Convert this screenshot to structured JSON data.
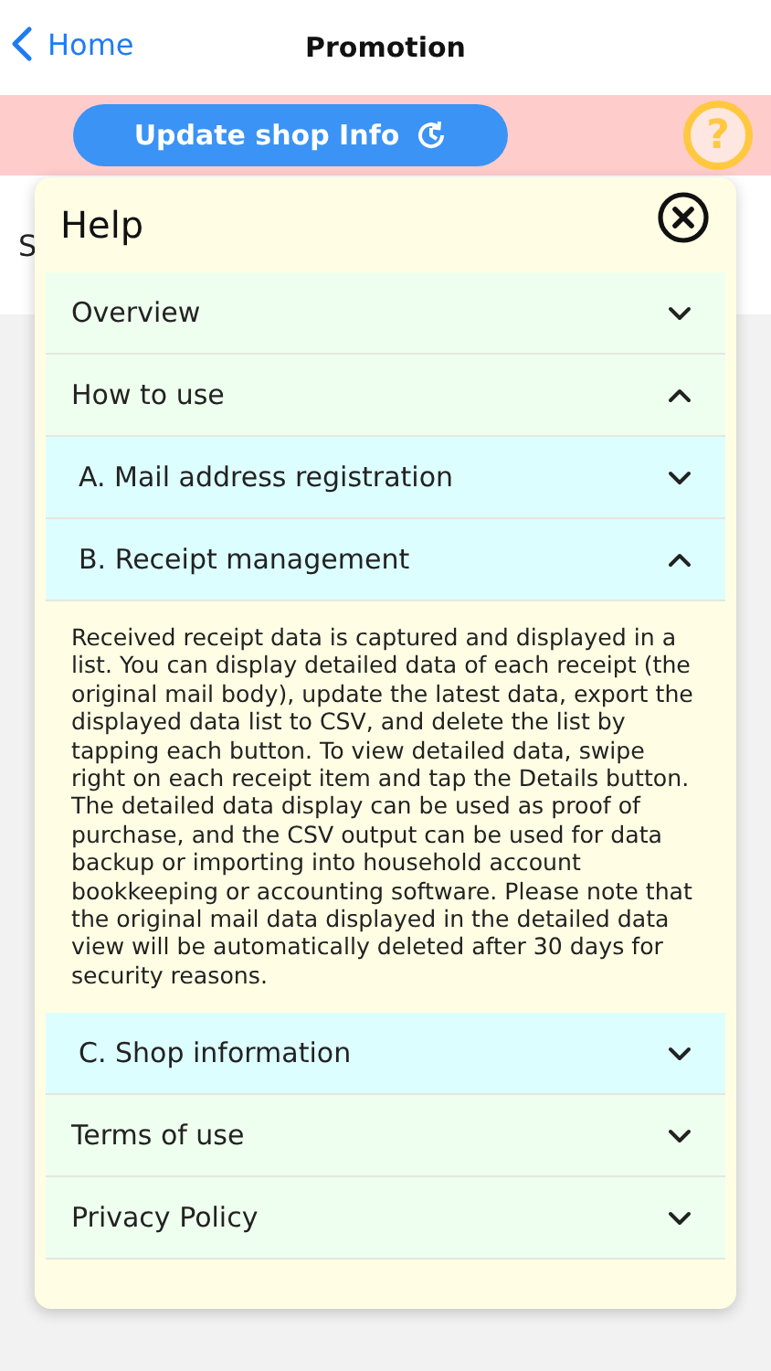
{
  "nav": {
    "back": "Home",
    "title": "Promotion"
  },
  "toolbar": {
    "button": "Update shop Info",
    "help": "?"
  },
  "behind": {
    "text": "S"
  },
  "help": {
    "title": "Help",
    "sections": [
      {
        "label": "Overview",
        "expanded": false
      },
      {
        "label": "How to use",
        "expanded": true,
        "children": [
          {
            "label": "A. Mail address registration",
            "expanded": false
          },
          {
            "label": "B. Receipt management",
            "expanded": true,
            "body": "Received receipt data is captured and displayed in a list. You can display detailed data of each receipt (the original mail body), update the latest data, export the displayed data list to CSV, and delete the list by tapping each button. To view detailed data, swipe right on each receipt item and tap the Details button. The detailed data display can be used as proof of purchase, and the CSV output can be used for data backup or importing into household account bookkeeping or accounting software. Please note that the original mail data displayed in the detailed data view will be automatically deleted after 30 days for security reasons."
          },
          {
            "label": "C. Shop information",
            "expanded": false
          }
        ]
      },
      {
        "label": "Terms of use",
        "expanded": false
      },
      {
        "label": "Privacy Policy",
        "expanded": false
      }
    ]
  }
}
